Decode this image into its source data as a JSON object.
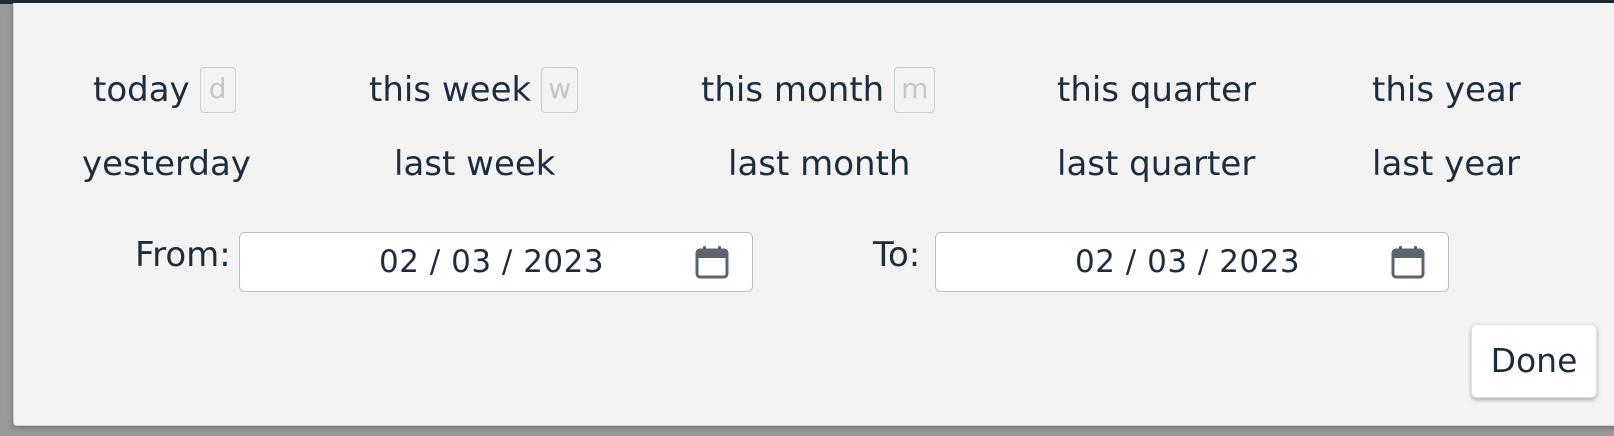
{
  "shortcuts_row1": [
    {
      "label": "today",
      "key": "d"
    },
    {
      "label": "this week",
      "key": "w"
    },
    {
      "label": "this month",
      "key": "m"
    },
    {
      "label": "this quarter"
    },
    {
      "label": "this year"
    }
  ],
  "shortcuts_row2": [
    {
      "label": "yesterday"
    },
    {
      "label": "last week"
    },
    {
      "label": "last month"
    },
    {
      "label": "last quarter"
    },
    {
      "label": "last year"
    }
  ],
  "from": {
    "label": "From:",
    "value": "02 / 03 / 2023",
    "icon": "calendar-icon"
  },
  "to": {
    "label": "To:",
    "value": "02 / 03 / 2023",
    "icon": "calendar-icon"
  },
  "done_label": "Done",
  "colors": {
    "text": "#1e2d3d",
    "panel": "#f3f3f3",
    "key_hint": "#c6c6c6",
    "topbar": "#1f2d3a"
  }
}
